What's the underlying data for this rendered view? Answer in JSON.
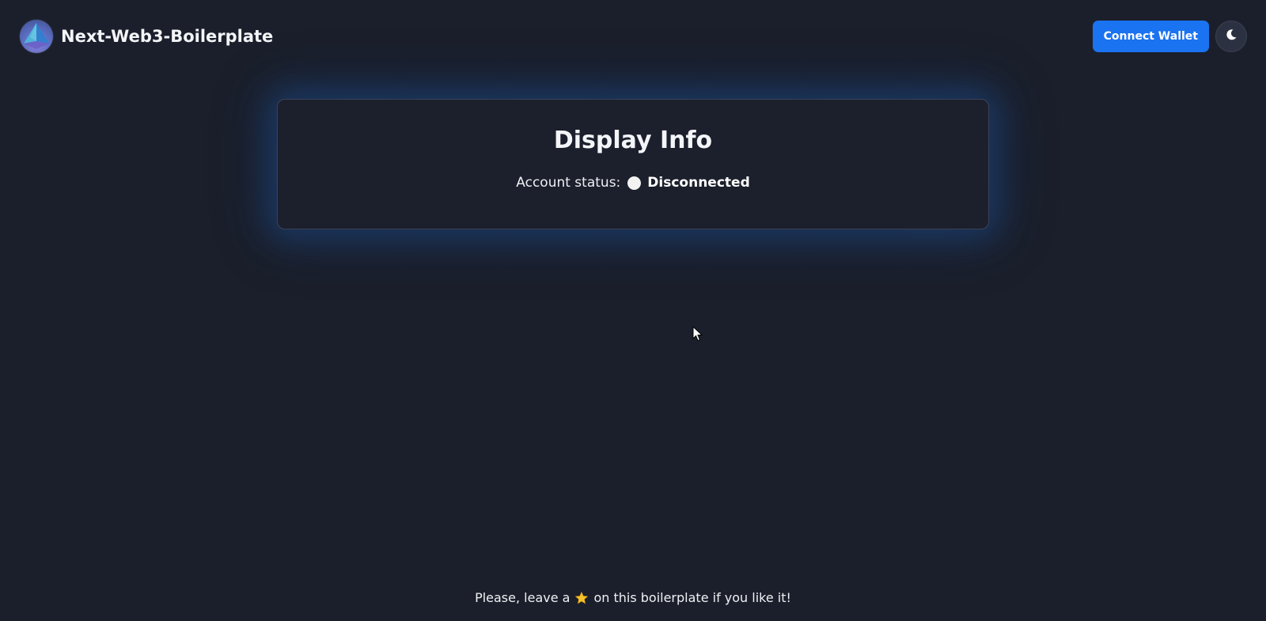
{
  "header": {
    "title": "Next-Web3-Boilerplate",
    "logo_icon": "pyramid-logo-icon",
    "connect_label": "Connect Wallet",
    "theme_icon": "moon-icon",
    "accent": "#1a73f0"
  },
  "card": {
    "title": "Display Info",
    "status_label": "Account status:",
    "status_value": "Disconnected",
    "status_color": "#f2f2f2"
  },
  "footer": {
    "text_before": "Please, leave a",
    "star_icon": "star-icon",
    "text_after": "on this boilerplate if you like it!"
  }
}
